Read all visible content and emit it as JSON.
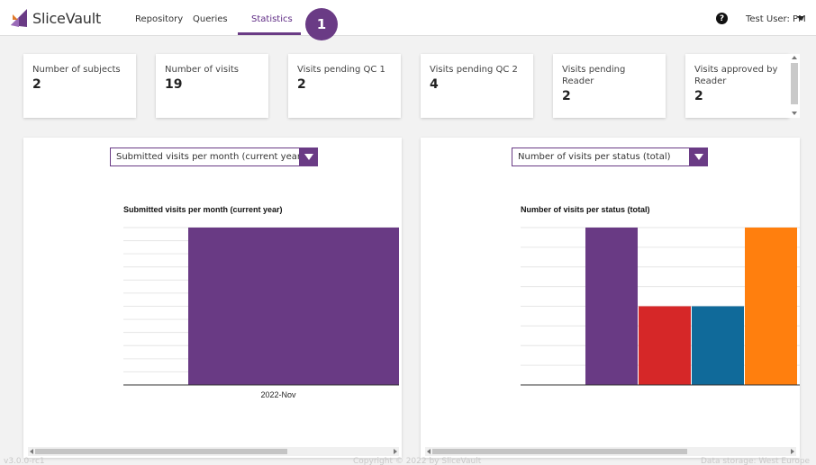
{
  "app": {
    "name": "SliceVault"
  },
  "nav": {
    "items": [
      {
        "label": "Repository"
      },
      {
        "label": "Queries"
      },
      {
        "label": "Statistics"
      }
    ],
    "active": "Statistics",
    "step_badge": "1"
  },
  "user": {
    "help_icon": "question-circle-icon",
    "name": "Test User: PM"
  },
  "stats": [
    {
      "label": "Number of subjects",
      "value": "2"
    },
    {
      "label": "Number of visits",
      "value": "19"
    },
    {
      "label": "Visits pending QC 1",
      "value": "2"
    },
    {
      "label": "Visits pending QC 2",
      "value": "4"
    },
    {
      "label": "Visits pending Reader",
      "value": "2"
    },
    {
      "label": "Visits approved by Reader",
      "value": "2"
    }
  ],
  "panels": {
    "left": {
      "select_value": "Submitted visits per month (current year)"
    },
    "right": {
      "select_value": "Number of visits per status (total)"
    }
  },
  "chart_data": [
    {
      "type": "bar",
      "title": "Submitted visits per month (current year)",
      "categories": [
        "2022-Nov"
      ],
      "values": [
        19
      ],
      "grid": true,
      "colors": [
        "#693a84"
      ]
    },
    {
      "type": "bar",
      "title": "Number of visits per status (total)",
      "categories": [
        "",
        "",
        "",
        ""
      ],
      "values": [
        4,
        2,
        2,
        4
      ],
      "grid": true,
      "colors": [
        "#693a84",
        "#d62728",
        "#106a9a",
        "#ff7f0e"
      ]
    }
  ],
  "footer": {
    "version": "v3.0.0-rc1",
    "copyright": "Copyright © 2022 by SliceVault",
    "storage": "Data storage: West Europe"
  },
  "colors": {
    "brand": "#6a3b85",
    "background": "#f2f2f2"
  }
}
